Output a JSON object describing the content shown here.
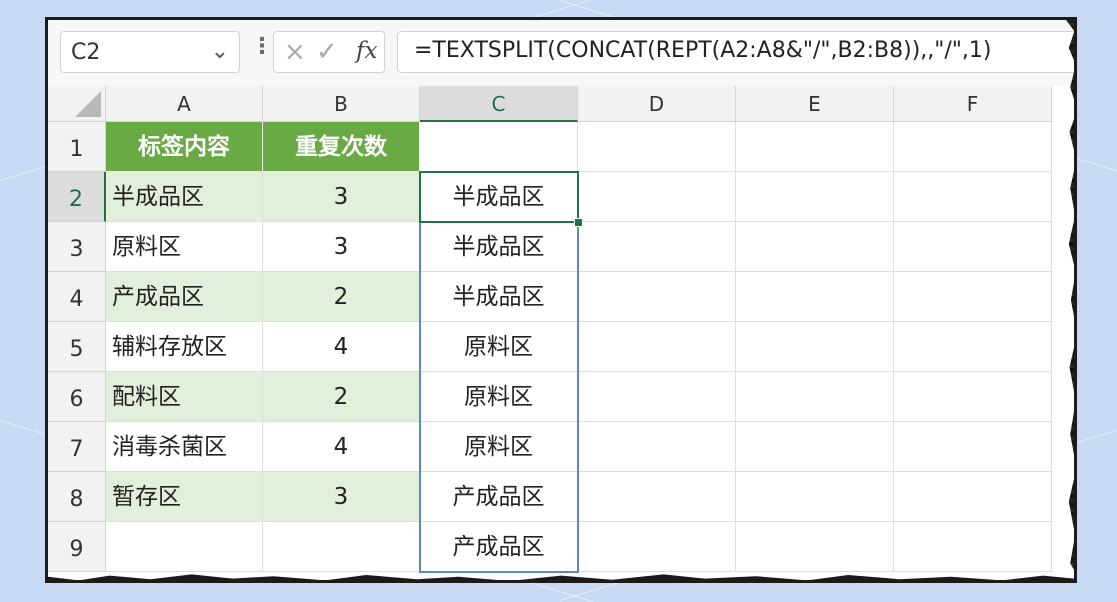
{
  "name_box": {
    "value": "C2",
    "chevron_icon": "chevron-down-icon"
  },
  "formula_bar": {
    "more_icon": "vertical-dots-icon",
    "cancel_icon": "×",
    "enter_icon": "✓",
    "fx_label": "fx",
    "formula": "=TEXTSPLIT(CONCAT(REPT(A2:A8&\"/\",B2:B8)),,\"/\",1)"
  },
  "columns": [
    "A",
    "B",
    "C",
    "D",
    "E",
    "F"
  ],
  "rows": [
    "1",
    "2",
    "3",
    "4",
    "5",
    "6",
    "7",
    "8",
    "9"
  ],
  "table": {
    "headers": [
      "标签内容",
      "重复次数"
    ],
    "rows": [
      {
        "label": "半成品区",
        "count": "3"
      },
      {
        "label": "原料区",
        "count": "3"
      },
      {
        "label": "产成品区",
        "count": "2"
      },
      {
        "label": "辅料存放区",
        "count": "4"
      },
      {
        "label": "配料区",
        "count": "2"
      },
      {
        "label": "消毒杀菌区",
        "count": "4"
      },
      {
        "label": "暂存区",
        "count": "3"
      }
    ]
  },
  "spill_results": [
    "半成品区",
    "半成品区",
    "半成品区",
    "原料区",
    "原料区",
    "原料区",
    "产成品区",
    "产成品区"
  ],
  "colors": {
    "header_green": "#6aaa45",
    "band_green": "#e2efda",
    "selection_green": "#217346",
    "spill_blue": "#5b87c5",
    "background": "#c8d9f4"
  }
}
